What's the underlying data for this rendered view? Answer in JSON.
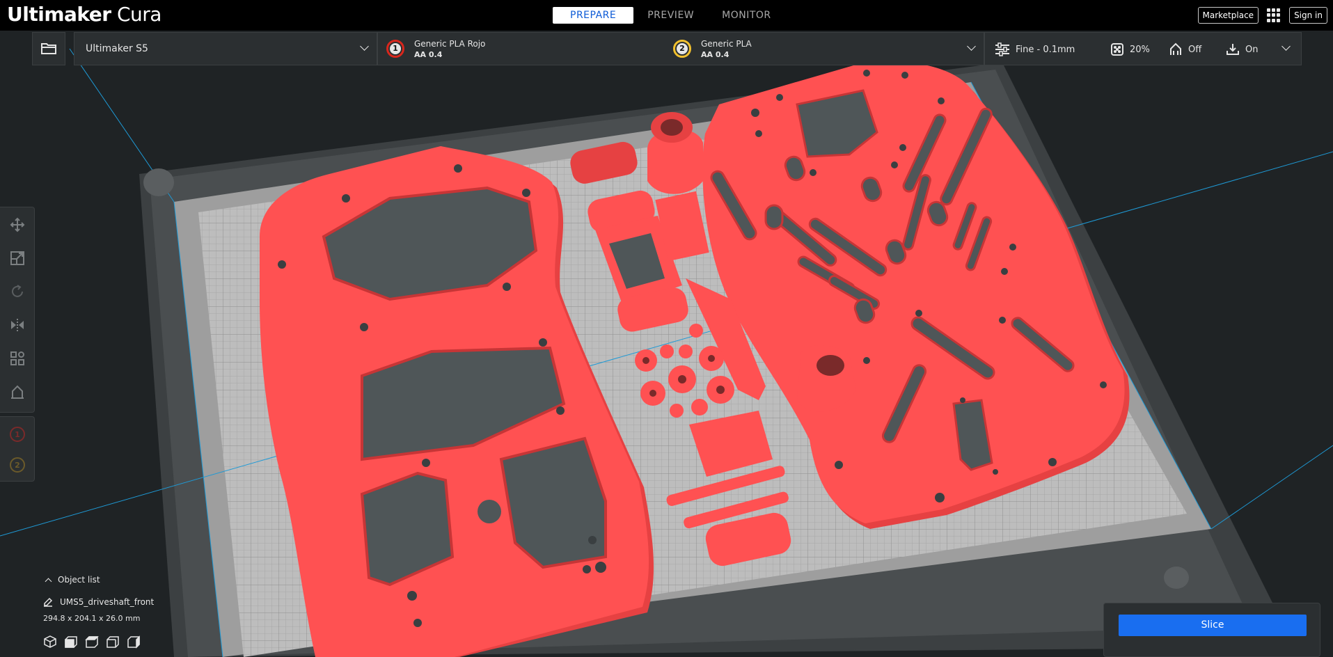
{
  "app": {
    "brand_bold": "Ultimaker",
    "brand_light": "Cura"
  },
  "stages": {
    "prepare": "PREPARE",
    "preview": "PREVIEW",
    "monitor": "MONITOR",
    "active": "prepare"
  },
  "topbar": {
    "marketplace": "Marketplace",
    "sign_in": "Sign in",
    "apps_icon": "grid-icon"
  },
  "machine": {
    "name": "Ultimaker S5"
  },
  "extruders": [
    {
      "number": "1",
      "material": "Generic PLA Rojo",
      "core": "AA 0.4",
      "color": "#d9261c"
    },
    {
      "number": "2",
      "material": "Generic PLA",
      "core": "AA 0.4",
      "color": "#f2c12e"
    }
  ],
  "print_settings": {
    "profile": "Fine - 0.1mm",
    "infill": "20%",
    "support": "Off",
    "adhesion": "On"
  },
  "tools": [
    "move-icon",
    "scale-icon",
    "rotate-icon",
    "mirror-icon",
    "per-model-settings-icon",
    "support-blocker-icon"
  ],
  "object_list": {
    "toggle_label": "Object list",
    "selected_object": "UMS5_driveshaft_front",
    "dimensions": "294.8 x 204.1 x 26.0 mm"
  },
  "view_buttons": [
    "3d-view-icon",
    "front-view-icon",
    "top-view-icon",
    "left-view-icon",
    "right-view-icon"
  ],
  "action": {
    "slice_label": "Slice"
  },
  "colors": {
    "accent": "#196ef0",
    "model_red": "#ff4d4f",
    "build_plate": "#c9c9c9",
    "background": "#1f2325"
  }
}
